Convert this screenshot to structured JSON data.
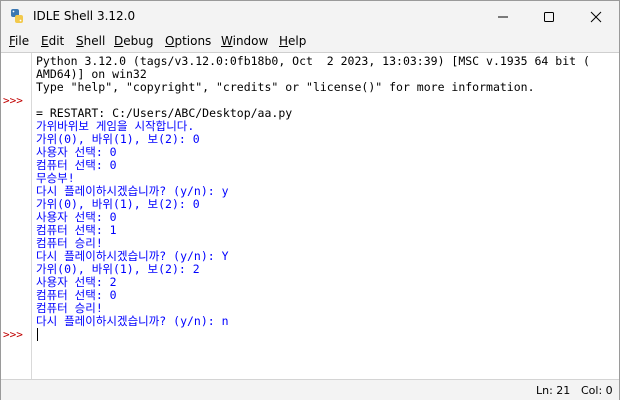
{
  "window": {
    "title": "IDLE Shell 3.12.0"
  },
  "menu": [
    "File",
    "Edit",
    "Shell",
    "Debug",
    "Options",
    "Window",
    "Help"
  ],
  "prompt_symbol": ">>>",
  "shell_lines": [
    {
      "text": "Python 3.12.0 (tags/v3.12.0:0fb18b0, Oct  2 2023, 13:03:39) [MSC v.1935 64 bit (",
      "kind": "out"
    },
    {
      "text": "AMD64)] on win32",
      "kind": "out"
    },
    {
      "text": "Type \"help\", \"copyright\", \"credits\" or \"license()\" for more information.",
      "kind": "out"
    },
    {
      "text": "",
      "kind": "out"
    },
    {
      "text": "= RESTART: C:/Users/ABC/Desktop/aa.py",
      "kind": "out"
    },
    {
      "text": "가위바위보 게임을 시작합니다.",
      "kind": "stdout"
    },
    {
      "text": "가위(0), 바위(1), 보(2): 0",
      "kind": "stdout"
    },
    {
      "text": "사용자 선택: 0",
      "kind": "stdout"
    },
    {
      "text": "컴퓨터 선택: 0",
      "kind": "stdout"
    },
    {
      "text": "무승부!",
      "kind": "stdout"
    },
    {
      "text": "다시 플레이하시겠습니까? (y/n): y",
      "kind": "stdout"
    },
    {
      "text": "가위(0), 바위(1), 보(2): 0",
      "kind": "stdout"
    },
    {
      "text": "사용자 선택: 0",
      "kind": "stdout"
    },
    {
      "text": "컴퓨터 선택: 1",
      "kind": "stdout"
    },
    {
      "text": "컴퓨터 승리!",
      "kind": "stdout"
    },
    {
      "text": "다시 플레이하시겠습니까? (y/n): Y",
      "kind": "stdout"
    },
    {
      "text": "가위(0), 바위(1), 보(2): 2",
      "kind": "stdout"
    },
    {
      "text": "사용자 선택: 2",
      "kind": "stdout"
    },
    {
      "text": "컴퓨터 선택: 0",
      "kind": "stdout"
    },
    {
      "text": "컴퓨터 승리!",
      "kind": "stdout"
    },
    {
      "text": "다시 플레이하시겠습니까? (y/n): n",
      "kind": "stdout"
    }
  ],
  "status": {
    "line": "Ln: 21",
    "col": "Col: 0"
  },
  "colors": {
    "stdout": "#0000ff",
    "prompt": "#c00000",
    "default": "#000000"
  }
}
